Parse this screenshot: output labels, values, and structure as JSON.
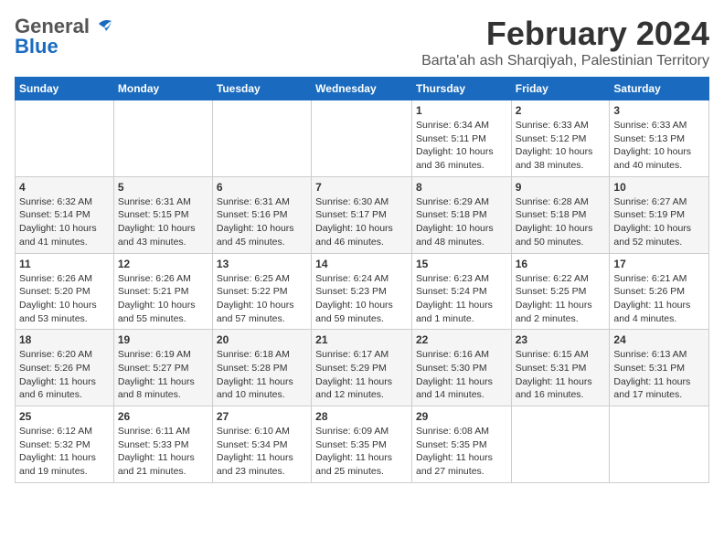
{
  "logo": {
    "general": "General",
    "blue": "Blue"
  },
  "header": {
    "month": "February 2024",
    "location": "Barta'ah ash Sharqiyah, Palestinian Territory"
  },
  "days_of_week": [
    "Sunday",
    "Monday",
    "Tuesday",
    "Wednesday",
    "Thursday",
    "Friday",
    "Saturday"
  ],
  "weeks": [
    [
      {
        "day": "",
        "info": ""
      },
      {
        "day": "",
        "info": ""
      },
      {
        "day": "",
        "info": ""
      },
      {
        "day": "",
        "info": ""
      },
      {
        "day": "1",
        "info": "Sunrise: 6:34 AM\nSunset: 5:11 PM\nDaylight: 10 hours\nand 36 minutes."
      },
      {
        "day": "2",
        "info": "Sunrise: 6:33 AM\nSunset: 5:12 PM\nDaylight: 10 hours\nand 38 minutes."
      },
      {
        "day": "3",
        "info": "Sunrise: 6:33 AM\nSunset: 5:13 PM\nDaylight: 10 hours\nand 40 minutes."
      }
    ],
    [
      {
        "day": "4",
        "info": "Sunrise: 6:32 AM\nSunset: 5:14 PM\nDaylight: 10 hours\nand 41 minutes."
      },
      {
        "day": "5",
        "info": "Sunrise: 6:31 AM\nSunset: 5:15 PM\nDaylight: 10 hours\nand 43 minutes."
      },
      {
        "day": "6",
        "info": "Sunrise: 6:31 AM\nSunset: 5:16 PM\nDaylight: 10 hours\nand 45 minutes."
      },
      {
        "day": "7",
        "info": "Sunrise: 6:30 AM\nSunset: 5:17 PM\nDaylight: 10 hours\nand 46 minutes."
      },
      {
        "day": "8",
        "info": "Sunrise: 6:29 AM\nSunset: 5:18 PM\nDaylight: 10 hours\nand 48 minutes."
      },
      {
        "day": "9",
        "info": "Sunrise: 6:28 AM\nSunset: 5:18 PM\nDaylight: 10 hours\nand 50 minutes."
      },
      {
        "day": "10",
        "info": "Sunrise: 6:27 AM\nSunset: 5:19 PM\nDaylight: 10 hours\nand 52 minutes."
      }
    ],
    [
      {
        "day": "11",
        "info": "Sunrise: 6:26 AM\nSunset: 5:20 PM\nDaylight: 10 hours\nand 53 minutes."
      },
      {
        "day": "12",
        "info": "Sunrise: 6:26 AM\nSunset: 5:21 PM\nDaylight: 10 hours\nand 55 minutes."
      },
      {
        "day": "13",
        "info": "Sunrise: 6:25 AM\nSunset: 5:22 PM\nDaylight: 10 hours\nand 57 minutes."
      },
      {
        "day": "14",
        "info": "Sunrise: 6:24 AM\nSunset: 5:23 PM\nDaylight: 10 hours\nand 59 minutes."
      },
      {
        "day": "15",
        "info": "Sunrise: 6:23 AM\nSunset: 5:24 PM\nDaylight: 11 hours\nand 1 minute."
      },
      {
        "day": "16",
        "info": "Sunrise: 6:22 AM\nSunset: 5:25 PM\nDaylight: 11 hours\nand 2 minutes."
      },
      {
        "day": "17",
        "info": "Sunrise: 6:21 AM\nSunset: 5:26 PM\nDaylight: 11 hours\nand 4 minutes."
      }
    ],
    [
      {
        "day": "18",
        "info": "Sunrise: 6:20 AM\nSunset: 5:26 PM\nDaylight: 11 hours\nand 6 minutes."
      },
      {
        "day": "19",
        "info": "Sunrise: 6:19 AM\nSunset: 5:27 PM\nDaylight: 11 hours\nand 8 minutes."
      },
      {
        "day": "20",
        "info": "Sunrise: 6:18 AM\nSunset: 5:28 PM\nDaylight: 11 hours\nand 10 minutes."
      },
      {
        "day": "21",
        "info": "Sunrise: 6:17 AM\nSunset: 5:29 PM\nDaylight: 11 hours\nand 12 minutes."
      },
      {
        "day": "22",
        "info": "Sunrise: 6:16 AM\nSunset: 5:30 PM\nDaylight: 11 hours\nand 14 minutes."
      },
      {
        "day": "23",
        "info": "Sunrise: 6:15 AM\nSunset: 5:31 PM\nDaylight: 11 hours\nand 16 minutes."
      },
      {
        "day": "24",
        "info": "Sunrise: 6:13 AM\nSunset: 5:31 PM\nDaylight: 11 hours\nand 17 minutes."
      }
    ],
    [
      {
        "day": "25",
        "info": "Sunrise: 6:12 AM\nSunset: 5:32 PM\nDaylight: 11 hours\nand 19 minutes."
      },
      {
        "day": "26",
        "info": "Sunrise: 6:11 AM\nSunset: 5:33 PM\nDaylight: 11 hours\nand 21 minutes."
      },
      {
        "day": "27",
        "info": "Sunrise: 6:10 AM\nSunset: 5:34 PM\nDaylight: 11 hours\nand 23 minutes."
      },
      {
        "day": "28",
        "info": "Sunrise: 6:09 AM\nSunset: 5:35 PM\nDaylight: 11 hours\nand 25 minutes."
      },
      {
        "day": "29",
        "info": "Sunrise: 6:08 AM\nSunset: 5:35 PM\nDaylight: 11 hours\nand 27 minutes."
      },
      {
        "day": "",
        "info": ""
      },
      {
        "day": "",
        "info": ""
      }
    ]
  ]
}
